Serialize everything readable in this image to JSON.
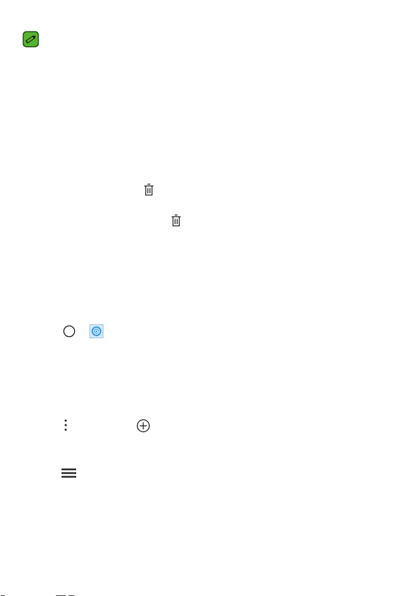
{
  "icons": {
    "note": "note-pencil-icon",
    "delete_1": "trash-icon",
    "delete_2": "trash-icon",
    "home": "home-circle-icon",
    "email_app": "email-app-icon",
    "more_options": "vertical-dots-icon",
    "add": "add-circle-icon",
    "menu": "hamburger-menu-icon"
  },
  "colors": {
    "note_green": "#4caf2a",
    "email_blue": "#2f8fd6",
    "icon_stroke": "#222222"
  }
}
